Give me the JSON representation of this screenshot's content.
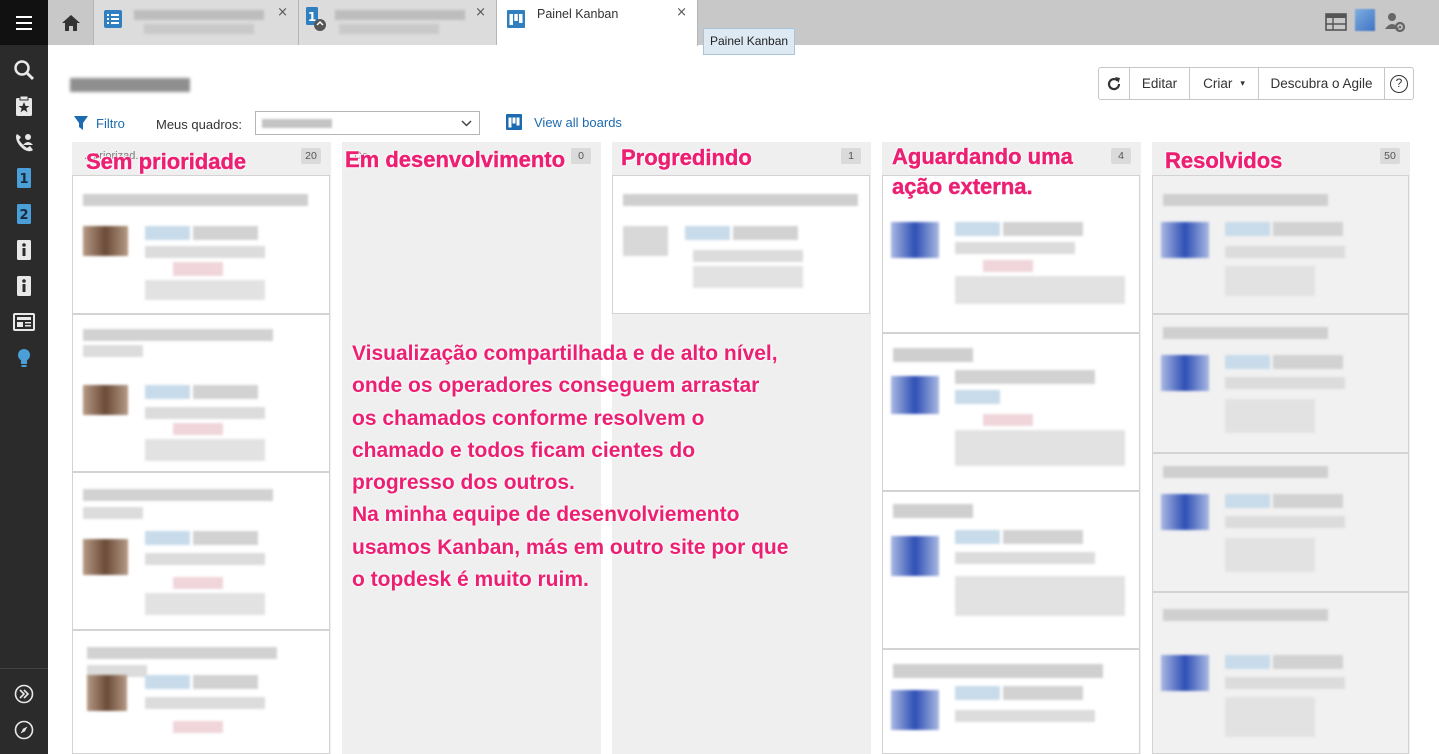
{
  "tabs": {
    "home_icon": "home-icon",
    "active_label": "Painel Kanban",
    "tooltip": "Painel Kanban",
    "close_glyph": "×"
  },
  "toolbar": {
    "refresh_icon": "refresh-icon",
    "edit": "Editar",
    "create": "Criar",
    "create_caret": "▾",
    "agile": "Descubra o Agile",
    "help": "?"
  },
  "filterbar": {
    "filter_label": "Filtro",
    "boards_label": "Meus quadros:",
    "view_all": "View all boards"
  },
  "columns": [
    {
      "title": "Sem prioridade",
      "count": "20",
      "header_hint": "...priorizad..."
    },
    {
      "title": "Em desenvolvimento",
      "count": "0",
      "header_hint": "De..."
    },
    {
      "title": "Progredindo",
      "count": "1",
      "header_hint": ""
    },
    {
      "title": "Aguardando uma ação externa.",
      "count": "4",
      "header_hint": ""
    },
    {
      "title": "Resolvidos",
      "count": "50",
      "header_hint": ""
    }
  ],
  "annotations": {
    "col1": "Sem prioridade",
    "col2": "Em desenvolvimento",
    "col3": "Progredindo",
    "col4_line1": "Aguardando uma",
    "col4_line2": "ação externa.",
    "col5": "Resolvidos",
    "body": [
      "Visualização compartilhada e de alto nível,",
      "onde os operadores conseguem  arrastar",
      "os chamados conforme resolvem o",
      "chamado e todos ficam cientes do",
      "progresso dos outros.",
      "Na minha equipe de desenvolviemento",
      "usamos Kanban, más em outro site por que",
      "o topdesk é muito ruim."
    ]
  },
  "colors": {
    "annotation": "#ec1f73",
    "link": "#1c6bb0",
    "sidebar": "#2b2b2b",
    "accent_icon": "#4a9fd8"
  }
}
